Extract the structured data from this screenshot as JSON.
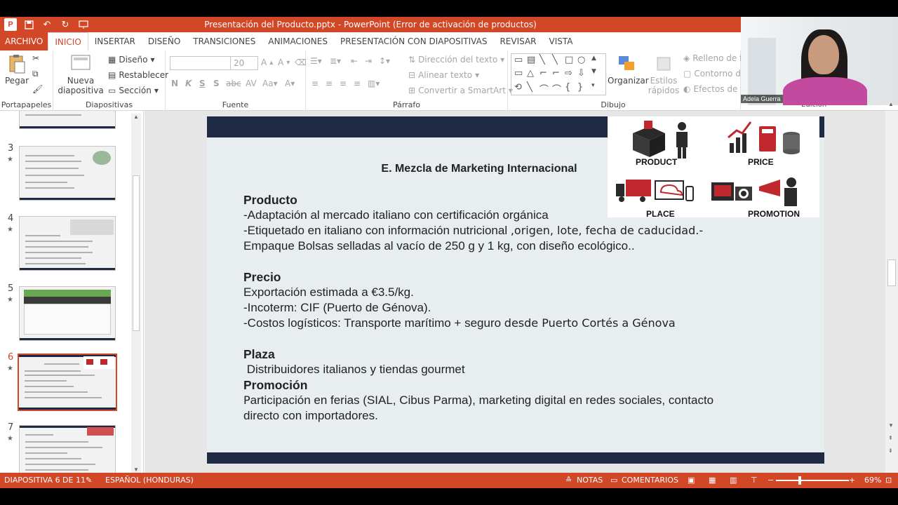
{
  "window": {
    "title": "Presentación del Producto.pptx -  PowerPoint (Error de activación de productos)",
    "app_icon_label": "P"
  },
  "tabs": [
    "ARCHIVO",
    "INICIO",
    "INSERTAR",
    "DISEÑO",
    "TRANSICIONES",
    "ANIMACIONES",
    "PRESENTACIÓN CON DIAPOSITIVAS",
    "REVISAR",
    "VISTA"
  ],
  "ribbon": {
    "clipboard": {
      "paste": "Pegar",
      "group": "Portapapeles"
    },
    "slides": {
      "new_slide_1": "Nueva",
      "new_slide_2": "diapositiva",
      "layout": "Diseño",
      "reset": "Restablecer",
      "section": "Sección",
      "group": "Diapositivas"
    },
    "font": {
      "size": "20",
      "bold": "N",
      "italic": "K",
      "underline": "S",
      "shadow": "S",
      "strike": "abc",
      "group": "Fuente"
    },
    "paragraph": {
      "direction": "Dirección del texto",
      "align": "Alinear texto",
      "smartart": "Convertir a SmartArt",
      "group": "Párrafo"
    },
    "drawing": {
      "arrange": "Organizar",
      "quick_styles_1": "Estilos",
      "quick_styles_2": "rápidos",
      "fill": "Relleno de f",
      "outline": "Contorno de",
      "effects": "Efectos de fo",
      "group": "Dibujo",
      "editing_group": "Edición"
    }
  },
  "webcam": {
    "name": "Adela Guerra"
  },
  "thumbnails": [
    {
      "num": "3"
    },
    {
      "num": "4"
    },
    {
      "num": "5"
    },
    {
      "num": "6",
      "active": true
    },
    {
      "num": "7"
    }
  ],
  "slide": {
    "title": "E. Mezcla de Marketing Internacional",
    "producto_h": "Producto",
    "producto_1": "-Adaptación al mercado italiano con certificación orgánica",
    "producto_2a": "-Etiquetado en  italiano con información nutricional ",
    "producto_2b": ",origen, lote, fecha de caducidad.-",
    "producto_3": "Empaque Bolsas selladas al vacío de 250 g y 1 kg, con diseño ecológico..",
    "precio_h": "Precio",
    "precio_1": "Exportación estimada a €3.5/kg.",
    "precio_2": "-Incoterm: CIF (Puerto de Génova).",
    "precio_3a": "-Costos logísticos: Transporte marítimo + seguro ",
    "precio_3b": "desde Puerto Cortés a Génova",
    "plaza_h": "Plaza",
    "plaza_1": " Distribuidores italianos y tiendas gourmet",
    "promocion_h": "Promoción",
    "promocion_1a": "P",
    "promocion_1b": "articipación en ferias (SIAL, Cibus Parma), marketing digital en redes sociales, contacto",
    "promocion_2": "directo con importadores.",
    "mix_labels": {
      "product": "PRODUCT",
      "price": "PRICE",
      "place": "PLACE",
      "promotion": "PROMOTION"
    }
  },
  "status": {
    "slide": "DIAPOSITIVA 6 DE 11",
    "language": "ESPAÑOL (HONDURAS)",
    "notes": "NOTAS",
    "comments": "COMENTARIOS",
    "zoom": "69%"
  },
  "colors": {
    "accent": "#d24726",
    "slide_band": "#1f2a44"
  }
}
